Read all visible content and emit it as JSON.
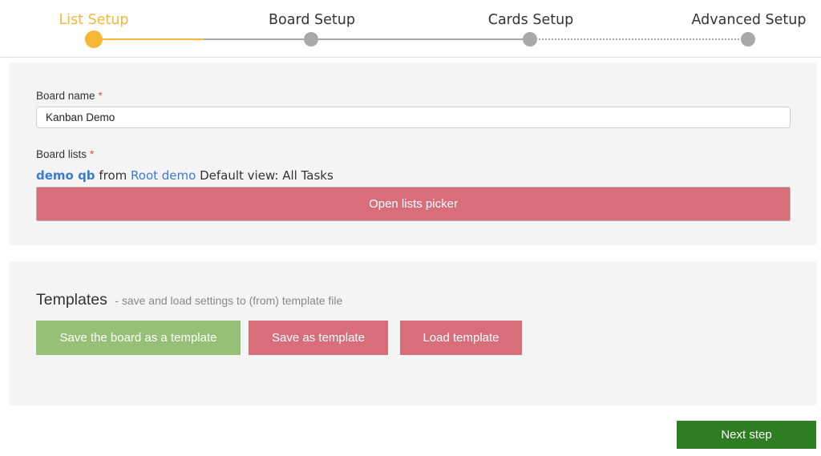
{
  "stepper": {
    "steps": [
      {
        "label": "List Setup",
        "state": "active"
      },
      {
        "label": "Board Setup",
        "state": "pending"
      },
      {
        "label": "Cards Setup",
        "state": "pending"
      },
      {
        "label": "Advanced Setup",
        "state": "pending"
      }
    ]
  },
  "board": {
    "name_label": "Board name",
    "name_required": "*",
    "name_value": "Kanban Demo",
    "lists_label": "Board lists",
    "lists_required": "*",
    "list_name": "demo qb",
    "from_text": "from",
    "source_name": "Root demo",
    "view_text": "Default view: All Tasks",
    "picker_button": "Open lists picker"
  },
  "templates": {
    "title": "Templates",
    "subtitle": "- save and load settings to (from) template file",
    "save_board_button": "Save the board as a template",
    "save_template_button": "Save as template",
    "load_template_button": "Load template"
  },
  "footer": {
    "next_button": "Next step"
  },
  "colors": {
    "accent": "#f5b735",
    "pink_button": "#d86e7a",
    "green_button": "#95c076",
    "next_button": "#2e7d23",
    "link": "#3d7bd0"
  }
}
